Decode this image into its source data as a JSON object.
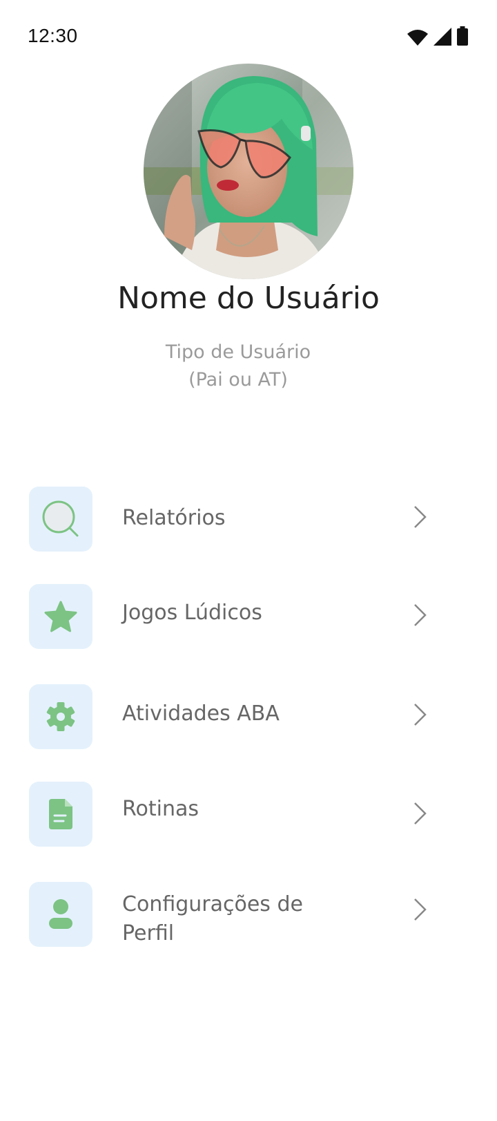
{
  "status_bar": {
    "time": "12:30",
    "icons": [
      "wifi-icon",
      "cellular-signal-icon",
      "battery-icon"
    ]
  },
  "profile": {
    "avatar": "user-photo",
    "name": "Nome do Usuário",
    "type_line1": "Tipo de Usuário",
    "type_line2": "(Pai ou AT)"
  },
  "colors": {
    "icon_green": "#7cc384",
    "icon_box_bg": "#e4f1fc",
    "label_gray": "#666666",
    "subtitle_gray": "#9a9a9a"
  },
  "menu": {
    "items": [
      {
        "label": "Relatórios",
        "icon": "search-icon"
      },
      {
        "label": "Jogos Lúdicos",
        "icon": "star-icon"
      },
      {
        "label": "Atividades ABA",
        "icon": "gear-icon"
      },
      {
        "label": "Rotinas",
        "icon": "document-icon"
      },
      {
        "label": "Configurações de Perfil",
        "icon": "person-icon"
      }
    ]
  }
}
